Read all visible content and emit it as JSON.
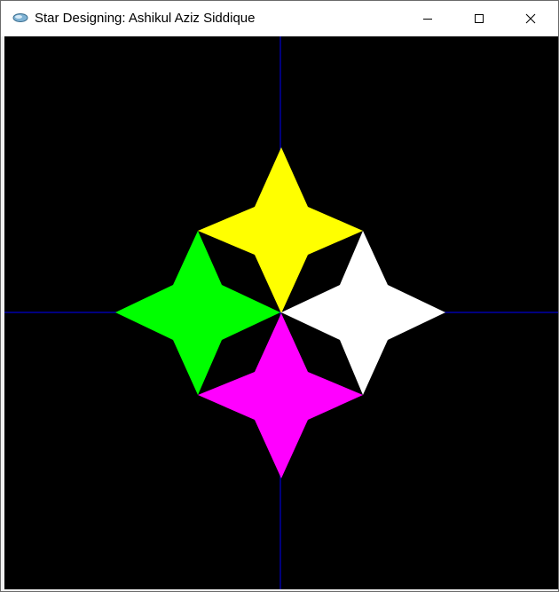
{
  "window": {
    "title": "Star Designing: Ashikul Aziz Siddique",
    "app_icon": "opengl-app-icon",
    "buttons": {
      "minimize_icon": "minimize-icon",
      "maximize_icon": "maximize-icon",
      "close_icon": "close-icon"
    }
  },
  "canvas": {
    "background_color": "#000000",
    "axis_color": "#0000cc",
    "stars": [
      {
        "name": "top-star",
        "color": "#ffff00"
      },
      {
        "name": "left-star",
        "color": "#00ff00"
      },
      {
        "name": "right-star",
        "color": "#ffffff"
      },
      {
        "name": "bottom-star",
        "color": "#ff00ff"
      }
    ]
  }
}
